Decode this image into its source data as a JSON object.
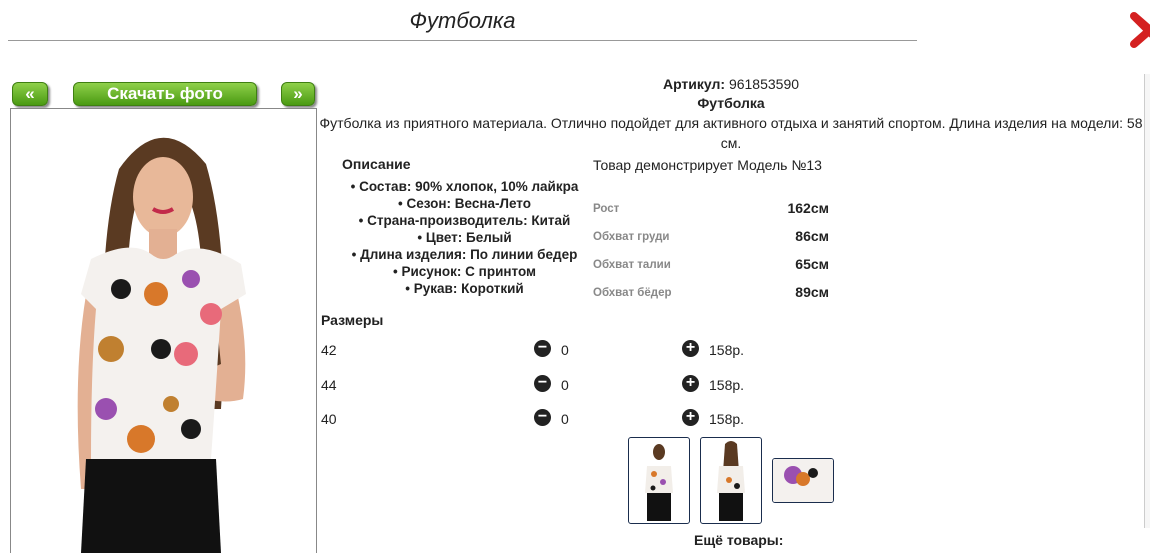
{
  "header": {
    "title": "Футболка"
  },
  "nav": {
    "prev_label": "«",
    "download_label": "Скачать фото",
    "next_label": "»"
  },
  "product": {
    "article_label": "Артикул:",
    "article_value": "961853590",
    "name": "Футболка",
    "description": "Футболка из приятного материала. Отлично подойдет для активного отдыха и занятий спортом. Длина изделия на модели: 58 см."
  },
  "details": {
    "title": "Описание",
    "items": [
      "• Состав: 90% хлопок, 10% лайкра",
      "• Сезон: Весна-Лето",
      "• Страна-производитель: Китай",
      "• Цвет: Белый",
      "• Длина изделия: По линии бедер",
      "• Рисунок: С принтом",
      "• Рукав: Короткий"
    ]
  },
  "model": {
    "heading": "Товар демонстрирует Модель №13",
    "measurements": [
      {
        "label": "Рост",
        "value": "162см"
      },
      {
        "label": "Обхват груди",
        "value": "86см"
      },
      {
        "label": "Обхват талии",
        "value": "65см"
      },
      {
        "label": "Обхват бёдер",
        "value": "89см"
      }
    ]
  },
  "sizes": {
    "title": "Размеры",
    "rows": [
      {
        "size": "42",
        "qty": "0",
        "price": "158р."
      },
      {
        "size": "44",
        "qty": "0",
        "price": "158р."
      },
      {
        "size": "40",
        "qty": "0",
        "price": "158р."
      }
    ]
  },
  "footer": {
    "more_label": "Ещё товары:"
  },
  "colors": {
    "accent_green": "#5aac1e",
    "close_red": "#d42020"
  }
}
